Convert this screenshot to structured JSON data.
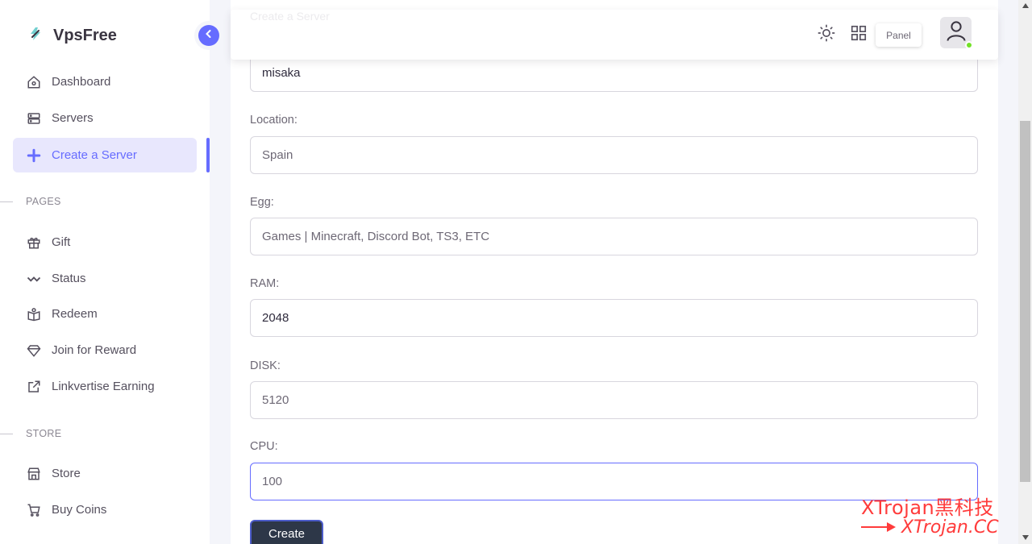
{
  "brand": {
    "name": "VpsFree"
  },
  "sidebar": {
    "items": [
      {
        "label": "Dashboard",
        "icon": "home-icon"
      },
      {
        "label": "Servers",
        "icon": "server-icon"
      },
      {
        "label": "Create a Server",
        "icon": "plus-icon",
        "active": true
      }
    ],
    "sections": [
      {
        "title": "PAGES",
        "items": [
          {
            "label": "Gift",
            "icon": "gift-icon"
          },
          {
            "label": "Status",
            "icon": "activity-icon"
          },
          {
            "label": "Redeem",
            "icon": "book-icon"
          },
          {
            "label": "Join for Reward",
            "icon": "diamond-icon"
          },
          {
            "label": "Linkvertise Earning",
            "icon": "external-link-icon"
          }
        ]
      },
      {
        "title": "STORE",
        "items": [
          {
            "label": "Store",
            "icon": "store-icon"
          },
          {
            "label": "Buy Coins",
            "icon": "cart-icon"
          }
        ]
      }
    ]
  },
  "navbar": {
    "panel_label": "Panel",
    "ghost_text": "Create a Server"
  },
  "form": {
    "name_value": "misaka",
    "location_label": "Location:",
    "location_value": "Spain",
    "egg_label": "Egg:",
    "egg_value": "Games | Minecraft, Discord Bot, TS3, ETC",
    "ram_label": "RAM:",
    "ram_value": "2048",
    "disk_label": "DISK:",
    "disk_value": "5120",
    "cpu_label": "CPU:",
    "cpu_value": "100",
    "submit_label": "Create"
  },
  "watermark": {
    "line1": "XTrojan黑科技",
    "line2": "XTrojan.CC"
  },
  "colors": {
    "accent": "#666cff",
    "active_bg": "#e8e7fd",
    "button_bg": "#2d3748",
    "status_online": "#72e128",
    "watermark": "#ff3b3b"
  }
}
